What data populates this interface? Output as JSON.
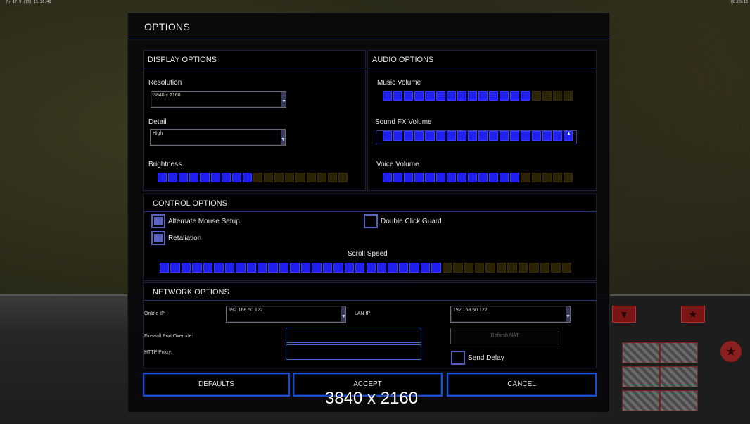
{
  "topbar": {
    "left_text": "  Fr 17.9 (15) 15:26:48",
    "right_text": "00:00:13"
  },
  "dialog": {
    "title": "OPTIONS"
  },
  "display": {
    "header": "DISPLAY OPTIONS",
    "resolution_label": "Resolution",
    "resolution_value": "3840 x 2160",
    "detail_label": "Detail",
    "detail_value": "High",
    "brightness_label": "Brightness",
    "brightness_level": 0.5
  },
  "audio": {
    "header": "AUDIO OPTIONS",
    "music_label": "Music Volume",
    "music_level": 0.8,
    "sfx_label": "Sound FX Volume",
    "sfx_level": 1.0,
    "voice_label": "Voice Volume",
    "voice_level": 0.7
  },
  "control": {
    "header": "CONTROL OPTIONS",
    "alt_mouse_label": "Alternate Mouse Setup",
    "alt_mouse_checked": true,
    "retaliation_label": "Retaliation",
    "retaliation_checked": true,
    "double_click_label": "Double Click Guard",
    "double_click_checked": false,
    "scroll_speed_label": "Scroll Speed",
    "scroll_speed_level": 0.68
  },
  "network": {
    "header": "NETWORK OPTIONS",
    "online_ip_label": "Online IP:",
    "online_ip_value": "192.168.50.122",
    "lan_ip_label": "LAN IP:",
    "lan_ip_value": "192.168.50.122",
    "firewall_label": "Firewall Port Override:",
    "firewall_value": "",
    "http_proxy_label": "HTTP Proxy:",
    "http_proxy_value": "",
    "refresh_nat_label": "Refresh NAT",
    "send_delay_label": "Send Delay",
    "send_delay_checked": false
  },
  "buttons": {
    "defaults": "DEFAULTS",
    "accept": "ACCEPT",
    "cancel": "CANCEL"
  },
  "tooltip": {
    "text": "3840 x 2160"
  },
  "colors": {
    "accent": "#1f1ff0",
    "frame": "#1c4fd0",
    "off_segment": "#2c2206"
  }
}
